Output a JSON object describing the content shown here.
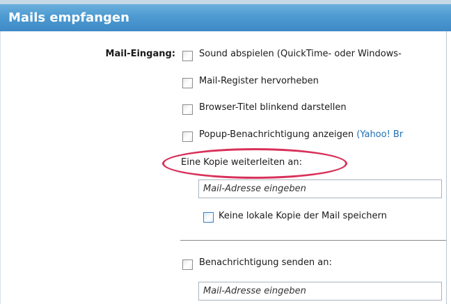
{
  "header": {
    "title": "Mails empfangen"
  },
  "mail_incoming": {
    "label": "Mail-Eingang:",
    "options": [
      {
        "label": "Sound abspielen (QuickTime- oder Windows-",
        "checked": false
      },
      {
        "label": "Mail-Register hervorheben",
        "checked": false
      },
      {
        "label": "Browser-Titel blinkend darstellen",
        "checked": false
      },
      {
        "label": "Popup-Benachrichtigung anzeigen",
        "link": "(Yahoo! Br",
        "checked": false
      }
    ]
  },
  "forward": {
    "label": "Eine Kopie weiterleiten an:",
    "placeholder": "Mail-Adresse eingeben",
    "no_local_copy": {
      "label": "Keine lokale Kopie der Mail speichern",
      "checked": false
    }
  },
  "notify": {
    "label": "Benachrichtigung senden an:",
    "checked": false,
    "placeholder": "Mail-Adresse eingeben"
  },
  "colors": {
    "header": "#4d9ad1",
    "highlight": "#d8315a",
    "link": "#1f6fb5"
  }
}
